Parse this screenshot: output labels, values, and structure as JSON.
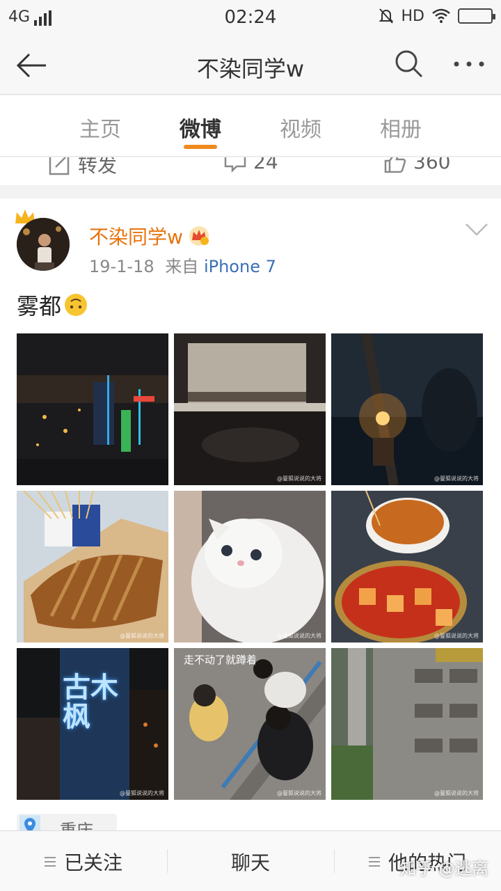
{
  "status_bar": {
    "network": "4G",
    "time": "02:24",
    "hd": "HD"
  },
  "header": {
    "title": "不染同学w"
  },
  "tabs": [
    {
      "label": "主页",
      "active": false
    },
    {
      "label": "微博",
      "active": true
    },
    {
      "label": "视频",
      "active": false
    },
    {
      "label": "相册",
      "active": false
    }
  ],
  "prev_post_actions": {
    "repost": "转发",
    "comments": "24",
    "likes": "360"
  },
  "post": {
    "username": "不染同学w",
    "date": "19-1-18",
    "source_prefix": "来自",
    "source": "iPhone 7",
    "text": "雾都",
    "photos": [
      {
        "name": "city-night-photo",
        "watermark": ""
      },
      {
        "name": "bar-interior-photo",
        "watermark": "@曼狐说说的大将"
      },
      {
        "name": "candle-window-photo",
        "watermark": "@曼狐说说的大将"
      },
      {
        "name": "grilled-fish-photo",
        "watermark": "@曼狐说说的大将"
      },
      {
        "name": "white-cat-photo",
        "watermark": "@曼狐说说的大将"
      },
      {
        "name": "spicy-tofu-photo",
        "watermark": "@曼狐说说的大将"
      },
      {
        "name": "neon-sign-photo",
        "watermark": "@曼狐说说的大将",
        "sign_text": "古木枫"
      },
      {
        "name": "friends-squatting-photo",
        "watermark": "@曼狐说说的大将",
        "caption": "走不动了就蹲着"
      },
      {
        "name": "apartment-courtyard-photo",
        "watermark": "@曼狐说说的大将"
      }
    ],
    "location": "重庆"
  },
  "bottom_bar": {
    "following": "已关注",
    "chat": "聊天",
    "hot": "他的热门"
  },
  "watermark": "知乎 @逃离",
  "colors": {
    "accent": "#f08a1d",
    "username": "#e8730d",
    "source_link": "#3b6fb6"
  }
}
